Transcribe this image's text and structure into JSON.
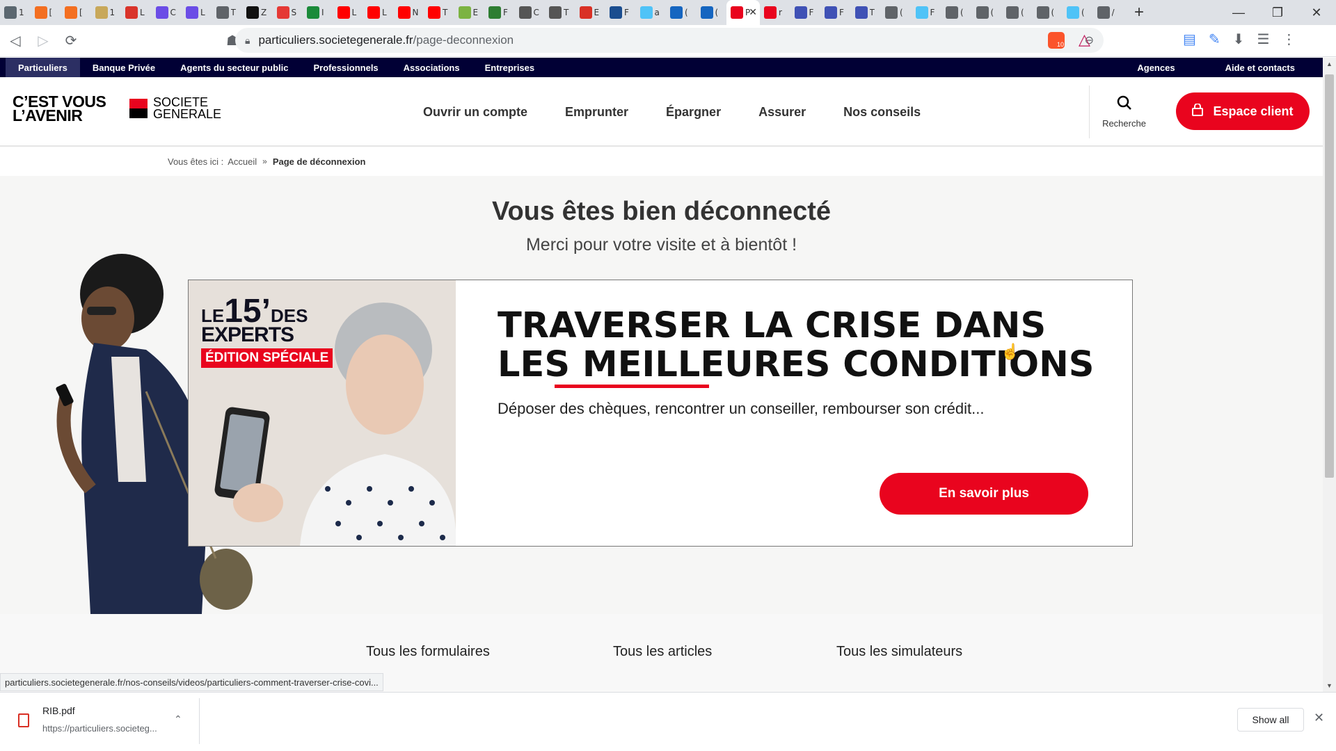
{
  "browser": {
    "tabs": [
      {
        "favicon_color": "#5b6770",
        "label": "1"
      },
      {
        "favicon_color": "#f36f21",
        "label": "["
      },
      {
        "favicon_color": "#f36f21",
        "label": "["
      },
      {
        "favicon_color": "#c8a85a",
        "label": "1"
      },
      {
        "favicon_color": "#d9342b",
        "label": "L"
      },
      {
        "favicon_color": "#6b4de6",
        "label": "C"
      },
      {
        "favicon_color": "#6b4de6",
        "label": "L"
      },
      {
        "favicon_color": "#5f6368",
        "label": "T"
      },
      {
        "favicon_color": "#111111",
        "label": "Z"
      },
      {
        "favicon_color": "#e53935",
        "label": "S"
      },
      {
        "favicon_color": "#1b8a3a",
        "label": "I"
      },
      {
        "favicon_color": "#ff0000",
        "label": "L"
      },
      {
        "favicon_color": "#ff0000",
        "label": "L"
      },
      {
        "favicon_color": "#ff0000",
        "label": "N"
      },
      {
        "favicon_color": "#ff0000",
        "label": "T"
      },
      {
        "favicon_color": "#7cb342",
        "label": "E"
      },
      {
        "favicon_color": "#2e7d32",
        "label": "F"
      },
      {
        "favicon_color": "#555555",
        "label": "C"
      },
      {
        "favicon_color": "#555555",
        "label": "T"
      },
      {
        "favicon_color": "#d93025",
        "label": "E"
      },
      {
        "favicon_color": "#1a4d8f",
        "label": "F"
      },
      {
        "favicon_color": "#4fc3f7",
        "label": "a"
      },
      {
        "favicon_color": "#1565c0",
        "label": "("
      },
      {
        "favicon_color": "#1565c0",
        "label": "("
      }
    ],
    "active_tab": {
      "label": "P",
      "favicon_color": "#e9041e"
    },
    "tabs_after": [
      {
        "favicon_color": "#e9041e",
        "label": "r"
      },
      {
        "favicon_color": "#3f51b5",
        "label": "F"
      },
      {
        "favicon_color": "#3f51b5",
        "label": "F"
      },
      {
        "favicon_color": "#3f51b5",
        "label": "T"
      },
      {
        "favicon_color": "#5f6368",
        "label": "("
      },
      {
        "favicon_color": "#4fc3f7",
        "label": "F"
      },
      {
        "favicon_color": "#5f6368",
        "label": "("
      },
      {
        "favicon_color": "#5f6368",
        "label": "("
      },
      {
        "favicon_color": "#5f6368",
        "label": "("
      },
      {
        "favicon_color": "#5f6368",
        "label": "("
      },
      {
        "favicon_color": "#4fc3f7",
        "label": "("
      },
      {
        "favicon_color": "#5f6368",
        "label": "/"
      }
    ],
    "url_host": "particuliers.societegenerale.fr",
    "url_path": "/page-deconnexion",
    "brave_count": "10"
  },
  "topbar": {
    "segments": [
      "Particuliers",
      "Banque Privée",
      "Agents du secteur public",
      "Professionnels",
      "Associations",
      "Entreprises"
    ],
    "right": [
      "Agences",
      "Aide et contacts"
    ]
  },
  "header": {
    "slogan_line1": "C’EST VOUS",
    "slogan_line2": "L’AVENIR",
    "brand_line1": "SOCIETE",
    "brand_line2": "GENERALE",
    "nav": [
      "Ouvrir un compte",
      "Emprunter",
      "Épargner",
      "Assurer",
      "Nos conseils"
    ],
    "search_label": "Recherche",
    "espace_client": "Espace client"
  },
  "breadcrumb": {
    "prefix": "Vous êtes ici :",
    "home": "Accueil",
    "current": "Page de déconnexion"
  },
  "hero": {
    "title": "Vous êtes bien déconnecté",
    "subtitle": "Merci pour votre visite et à bientôt !"
  },
  "promo": {
    "badge_le": "LE",
    "badge_num": "15’",
    "badge_des": "DES",
    "badge_experts": "EXPERTS",
    "badge_edition": "ÉDITION SPÉCIALE",
    "title_line1": "TRAVERSER LA CRISE DANS",
    "title_line2": "LES MEILLEURES CONDITIONS",
    "description": "Déposer des chèques, rencontrer un conseiller, rembourser son crédit...",
    "button": "En savoir plus"
  },
  "links": [
    "Tous les formulaires",
    "Tous les articles",
    "Tous les simulateurs"
  ],
  "status_url": "particuliers.societegenerale.fr/nos-conseils/videos/particuliers-comment-traverser-crise-covi...",
  "downloads": {
    "file_name": "RIB.pdf",
    "file_source": "https://particuliers.societeg...",
    "show_all": "Show all"
  }
}
